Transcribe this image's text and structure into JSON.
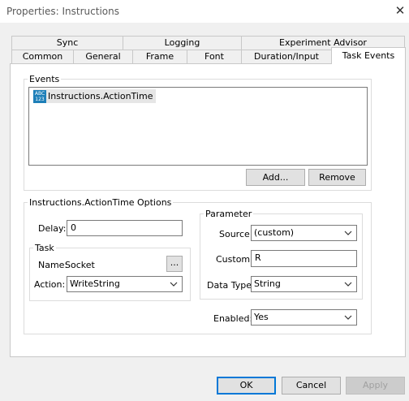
{
  "window": {
    "title": "Properties: Instructions",
    "close_glyph": "✕"
  },
  "tabs": {
    "row_top": [
      "Sync",
      "Logging",
      "Experiment Advisor"
    ],
    "row_bottom": [
      "Common",
      "General",
      "Frame",
      "Font",
      "Duration/Input",
      "Task Events"
    ],
    "active": "Task Events"
  },
  "events": {
    "group_label": "Events",
    "items": [
      {
        "icon": "abc-123-icon",
        "icon_text_top": "ABC",
        "icon_text_bottom": "123",
        "label": "Instructions.ActionTime"
      }
    ],
    "add_label": "Add...",
    "remove_label": "Remove"
  },
  "options": {
    "group_label": "Instructions.ActionTime Options",
    "delay_label": "Delay:",
    "delay_value": "0",
    "task": {
      "group_label": "Task",
      "name_label": "Name:",
      "name_value": "Socket",
      "browse_label": "...",
      "action_label": "Action:",
      "action_value": "WriteString"
    },
    "parameter": {
      "group_label": "Parameter",
      "source_label": "Source:",
      "source_value": "(custom)",
      "custom_label": "Custom:",
      "custom_value": "R",
      "datatype_label": "Data Type:",
      "datatype_value": "String"
    },
    "enabled_label": "Enabled:",
    "enabled_value": "Yes"
  },
  "footer": {
    "ok_label": "OK",
    "cancel_label": "Cancel",
    "apply_label": "Apply"
  },
  "colors": {
    "accent": "#0078d7",
    "icon_blue": "#1e7fb8"
  }
}
